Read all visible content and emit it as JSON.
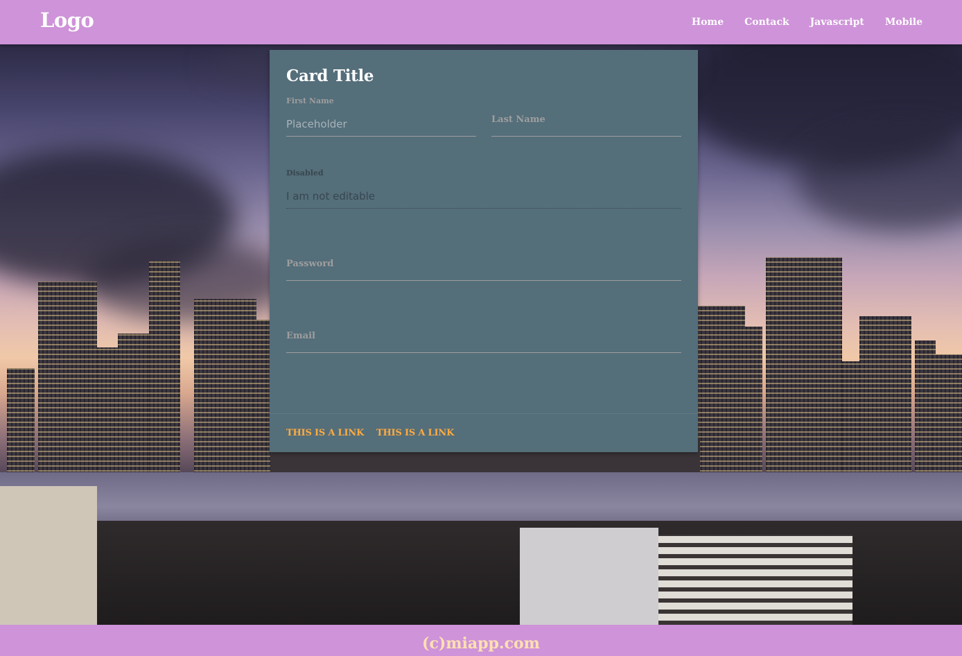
{
  "header": {
    "logo": "Logo",
    "nav": {
      "home": "Home",
      "contact": "Contack",
      "javascript": "Javascript",
      "mobile": "Mobile"
    },
    "background_color": "#ce93d8"
  },
  "card": {
    "title": "Card Title",
    "background_color": "#546e7a",
    "fields": {
      "first_name_label": "First Name",
      "first_name_placeholder": "Placeholder",
      "last_name_label": "Last Name",
      "disabled_label": "Disabled",
      "disabled_value": "I am not editable",
      "password_label": "Password",
      "email_label": "Email"
    },
    "actions": {
      "link1": "This is a link",
      "link2": "This is a link",
      "link_color": "#ffab40"
    }
  },
  "footer": {
    "text": "(c)miapp.com"
  }
}
